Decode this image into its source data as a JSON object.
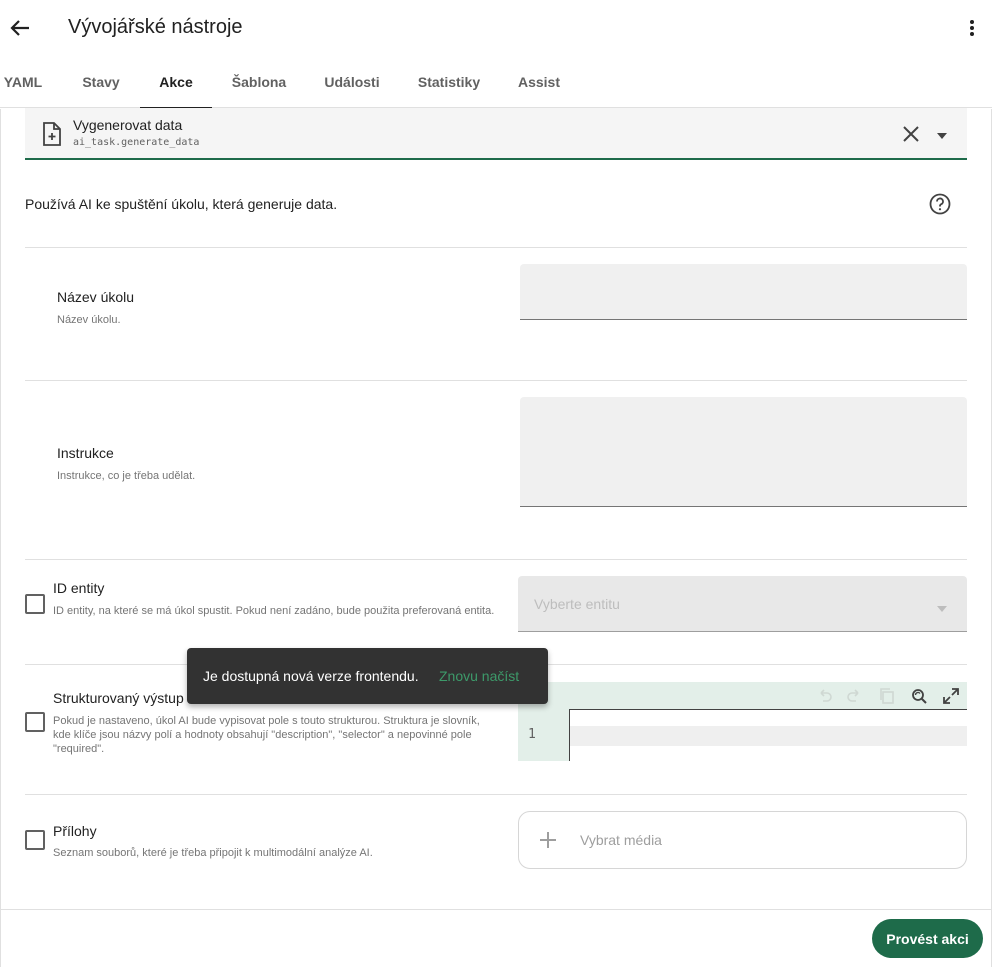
{
  "app": {
    "title": "Vývojářské nástroje"
  },
  "tabs": [
    {
      "label": "YAML"
    },
    {
      "label": "Stavy"
    },
    {
      "label": "Akce"
    },
    {
      "label": "Šablona"
    },
    {
      "label": "Události"
    },
    {
      "label": "Statistiky"
    },
    {
      "label": "Assist"
    }
  ],
  "active_tab": "Akce",
  "action": {
    "name": "Vygenerovat data",
    "id": "ai_task.generate_data",
    "description": "Používá AI ke spuštění úkolu, která generuje data."
  },
  "fields": {
    "task_name": {
      "label": "Název úkolu",
      "help": "Název úkolu.",
      "value": ""
    },
    "instructions": {
      "label": "Instrukce",
      "help": "Instrukce, co je třeba udělat.",
      "value": ""
    },
    "entity_id": {
      "label": "ID entity",
      "help": "ID entity, na které se má úkol spustit. Pokud není zadáno, bude použita preferovaná entita.",
      "placeholder": "Vyberte entitu",
      "checked": false
    },
    "structure": {
      "label": "Strukturovaný výstup",
      "help": "Pokud je nastaveno, úkol AI bude vypisovat pole s touto strukturou. Struktura je slovník, kde klíče jsou názvy polí a hodnoty obsahují \"description\", \"selector\" a nepovinné pole \"required\".",
      "line_number": "1",
      "checked": false
    },
    "attachments": {
      "label": "Přílohy",
      "help": "Seznam souborů, které je třeba připojit k multimodální analýze AI.",
      "button_label": "Vybrat média",
      "checked": false
    }
  },
  "snackbar": {
    "message": "Je dostupná nová verze frontendu.",
    "action": "Znovu načíst"
  },
  "run_button": "Provést akci",
  "colors": {
    "primary": "#1e6b4a",
    "snackbar_bg": "#323232",
    "snackbar_action": "#3d9a6a",
    "field_bg": "#f0f0f0"
  },
  "icons": [
    "back-arrow-icon",
    "more-vert-icon",
    "file-plus-icon",
    "close-icon",
    "dropdown-caret-icon",
    "help-circle-icon",
    "undo-icon",
    "redo-icon",
    "copy-icon",
    "find-replace-icon",
    "fullscreen-icon",
    "plus-icon"
  ]
}
